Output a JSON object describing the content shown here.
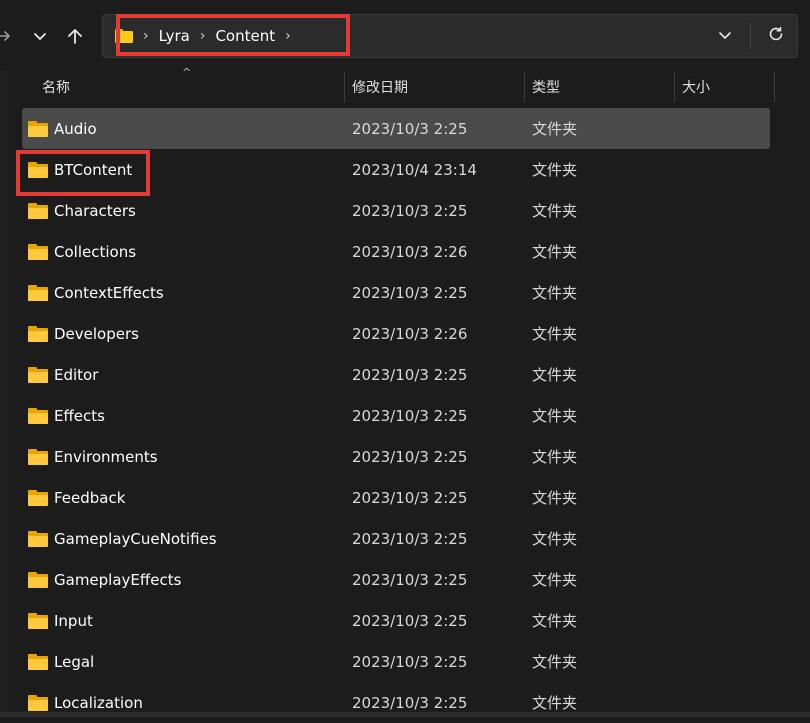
{
  "address": {
    "crumbs": [
      "Lyra",
      "Content"
    ],
    "folder_icon": "folder-icon"
  },
  "nav": {
    "forward_icon": "arrow-right-icon",
    "recent_icon": "chevron-down-icon",
    "up_icon": "arrow-up-icon",
    "dropdown_icon": "chevron-down-icon",
    "refresh_icon": "refresh-icon"
  },
  "columns": {
    "name": "名称",
    "date": "修改日期",
    "type": "类型",
    "size": "大小"
  },
  "rows": [
    {
      "name": "Audio",
      "date": "2023/10/3 2:25",
      "type": "文件夹"
    },
    {
      "name": "BTContent",
      "date": "2023/10/4 23:14",
      "type": "文件夹"
    },
    {
      "name": "Characters",
      "date": "2023/10/3 2:25",
      "type": "文件夹"
    },
    {
      "name": "Collections",
      "date": "2023/10/3 2:26",
      "type": "文件夹"
    },
    {
      "name": "ContextEffects",
      "date": "2023/10/3 2:25",
      "type": "文件夹"
    },
    {
      "name": "Developers",
      "date": "2023/10/3 2:26",
      "type": "文件夹"
    },
    {
      "name": "Editor",
      "date": "2023/10/3 2:25",
      "type": "文件夹"
    },
    {
      "name": "Effects",
      "date": "2023/10/3 2:25",
      "type": "文件夹"
    },
    {
      "name": "Environments",
      "date": "2023/10/3 2:25",
      "type": "文件夹"
    },
    {
      "name": "Feedback",
      "date": "2023/10/3 2:25",
      "type": "文件夹"
    },
    {
      "name": "GameplayCueNotifies",
      "date": "2023/10/3 2:25",
      "type": "文件夹"
    },
    {
      "name": "GameplayEffects",
      "date": "2023/10/3 2:25",
      "type": "文件夹"
    },
    {
      "name": "Input",
      "date": "2023/10/3 2:25",
      "type": "文件夹"
    },
    {
      "name": "Legal",
      "date": "2023/10/3 2:25",
      "type": "文件夹"
    },
    {
      "name": "Localization",
      "date": "2023/10/3 2:25",
      "type": "文件夹"
    }
  ],
  "selected_row": 0,
  "colors": {
    "background": "#1c1c1c",
    "selection": "#4a4a4a",
    "highlight_box": "#e53935",
    "folder": "#ffc83d"
  }
}
